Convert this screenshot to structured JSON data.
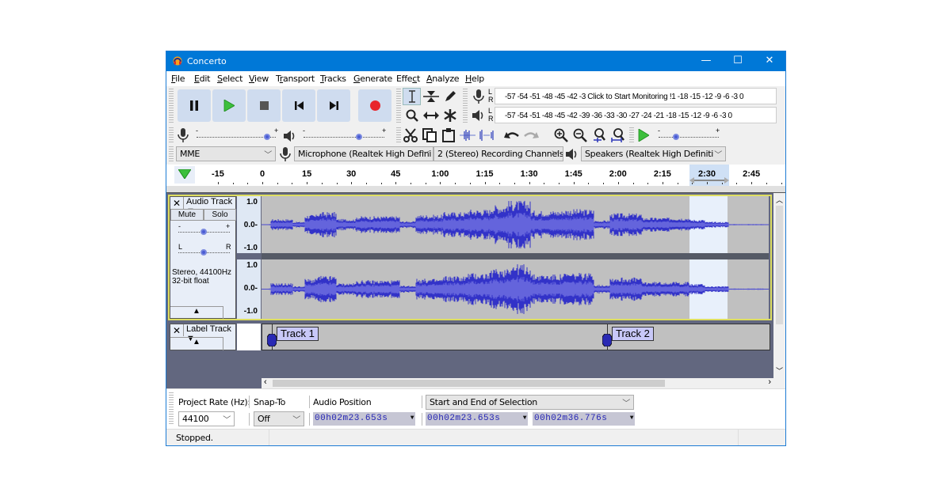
{
  "window": {
    "title": "Concerto",
    "minimize": "—",
    "maximize": "☐",
    "close": "✕"
  },
  "menu": [
    {
      "label": "File",
      "u": "F",
      "rest": "ile"
    },
    {
      "label": "Edit",
      "u": "E",
      "rest": "dit"
    },
    {
      "label": "Select",
      "u": "S",
      "rest": "elect"
    },
    {
      "label": "View",
      "u": "V",
      "rest": "iew"
    },
    {
      "label": "Transport",
      "pre": "T",
      "u": "r",
      "rest": "ansport"
    },
    {
      "label": "Tracks",
      "u": "T",
      "rest": "racks"
    },
    {
      "label": "Generate",
      "u": "G",
      "rest": "enerate"
    },
    {
      "label": "Effect",
      "pre": "Effe",
      "u": "c",
      "rest": "t"
    },
    {
      "label": "Analyze",
      "u": "A",
      "rest": "nalyze"
    },
    {
      "label": "Help",
      "u": "H",
      "rest": "elp"
    }
  ],
  "transport": {
    "pause": "pause-icon",
    "play": "play-icon",
    "stop": "stop-icon",
    "skip_start": "skip-to-start-icon",
    "skip_end": "skip-to-end-icon",
    "record": "record-icon"
  },
  "meters": {
    "record_scale": "-57 -54 -51 -48 -45 -42 -3",
    "record_prompt": "Click to Start Monitoring",
    "record_scale_tail": "!1 -18 -15 -12  -9   -6   -3   0",
    "playback_scale": "-57 -54 -51 -48 -45 -42 -39 -36 -33 -30 -27 -24 -21 -18 -15 -12  -9   -6   -3   0",
    "channel_l": "L",
    "channel_r": "R"
  },
  "mixer": {
    "record_volume": 0.9,
    "playback_volume": 0.7,
    "play_at_speed": 0.3,
    "minus": "-",
    "plus": "+"
  },
  "device": {
    "host": "MME",
    "recording_device": "Microphone (Realtek High Defini",
    "channels": "2 (Stereo) Recording Channels",
    "playback_device": "Speakers (Realtek High Definiti"
  },
  "timeline": {
    "labels": [
      "-15",
      "0",
      "15",
      "30",
      "45",
      "1:00",
      "1:15",
      "1:30",
      "1:45",
      "2:00",
      "2:15",
      "2:30",
      "2:45"
    ],
    "selection_start_label": "2:30"
  },
  "audio_track": {
    "name": "Audio Track",
    "mute": "Mute",
    "solo": "Solo",
    "gain_minus": "-",
    "gain_plus": "+",
    "pan_l": "L",
    "pan_r": "R",
    "gain": 0.5,
    "pan": 0.5,
    "info_line1": "Stereo, 44100Hz",
    "info_line2": "32-bit float",
    "scale_top": "1.0",
    "scale_mid": "0.0-",
    "scale_bot": "-1.0"
  },
  "label_track": {
    "name": "Label Track",
    "labels": [
      {
        "text": "Track 1"
      },
      {
        "text": "Track 2"
      }
    ]
  },
  "selection_bar": {
    "project_rate_label": "Project Rate (Hz):",
    "project_rate": "44100",
    "snap_to_label": "Snap-To",
    "snap_to": "Off",
    "audio_position_label": "Audio Position",
    "audio_position": "00h02m23.653s",
    "selection_mode": "Start and End of Selection",
    "selection_start": "00h02m23.653s",
    "selection_end": "00h02m36.776s"
  },
  "status": {
    "text": "Stopped."
  }
}
